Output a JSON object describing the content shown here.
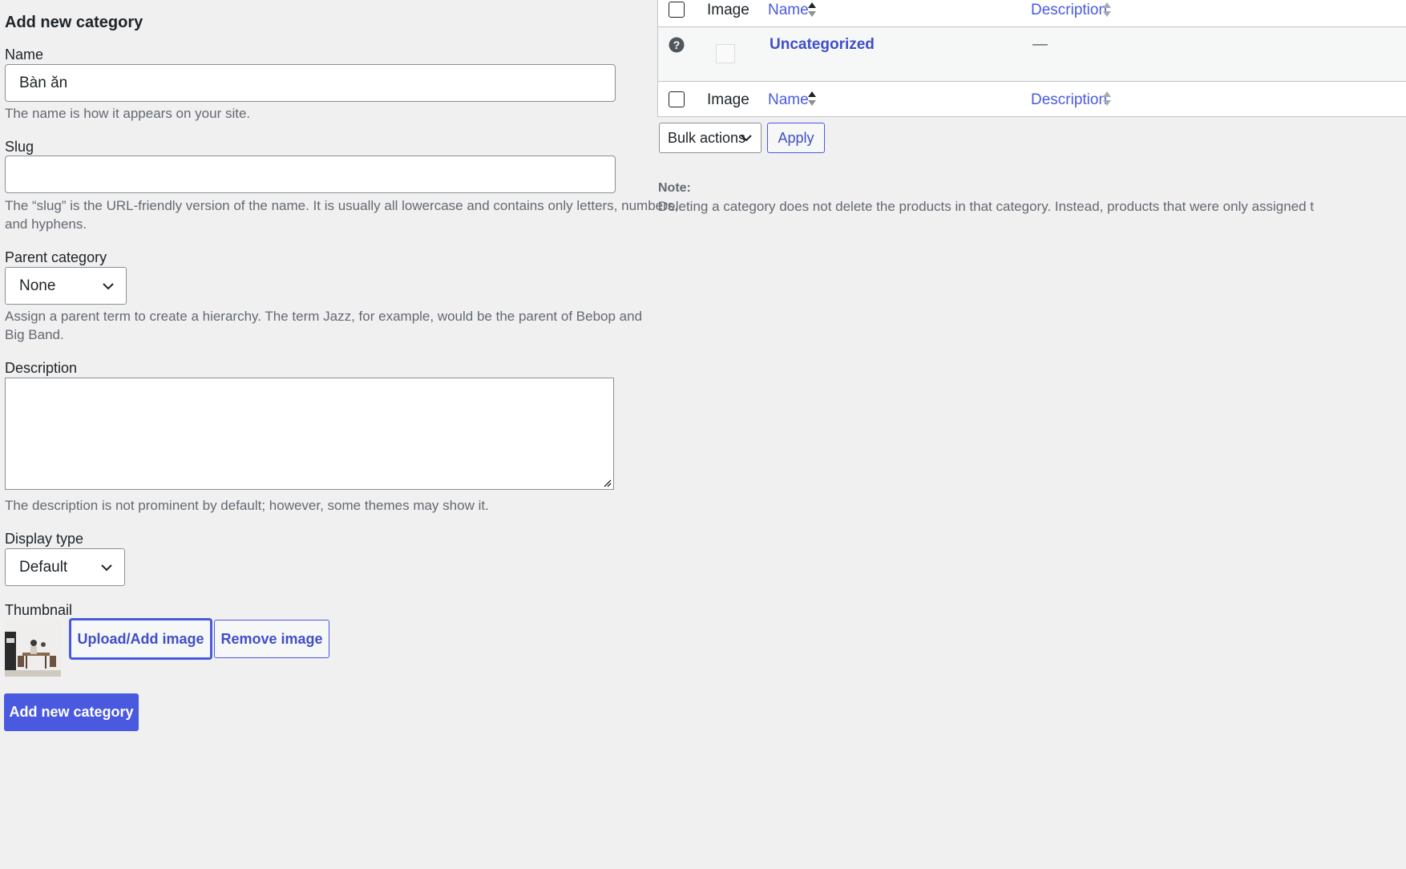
{
  "form": {
    "heading": "Add new category",
    "name_label": "Name",
    "name_value": "Bàn ăn",
    "name_help": "The name is how it appears on your site.",
    "slug_label": "Slug",
    "slug_value": "",
    "slug_help_line1": "The “slug” is the URL-friendly version of the name. It is usually all lowercase and contains only letters, numbers,",
    "slug_help_line2": "and hyphens.",
    "parent_label": "Parent category",
    "parent_value": "None",
    "parent_help_line1": "Assign a parent term to create a hierarchy. The term Jazz, for example, would be the parent of Bebop and",
    "parent_help_line2": "Big Band.",
    "description_label": "Description",
    "description_value": "",
    "description_help": "The description is not prominent by default; however, some themes may show it.",
    "display_type_label": "Display type",
    "display_type_value": "Default",
    "thumbnail_label": "Thumbnail",
    "upload_button": "Upload/Add image",
    "remove_button": "Remove image",
    "submit_button": "Add new category"
  },
  "table": {
    "columns": {
      "image": "Image",
      "name": "Name",
      "description": "Description"
    },
    "rows": [
      {
        "name": "Uncategorized",
        "description": "—"
      }
    ],
    "bulk_actions": "Bulk actions",
    "apply_button": "Apply"
  },
  "note": {
    "title": "Note:",
    "text": "Deleting a category does not delete the products in that category. Instead, products that were only assigned t"
  },
  "colors": {
    "accent": "#4a5ae0",
    "background": "#f0f0f1",
    "help_text": "#646970"
  }
}
